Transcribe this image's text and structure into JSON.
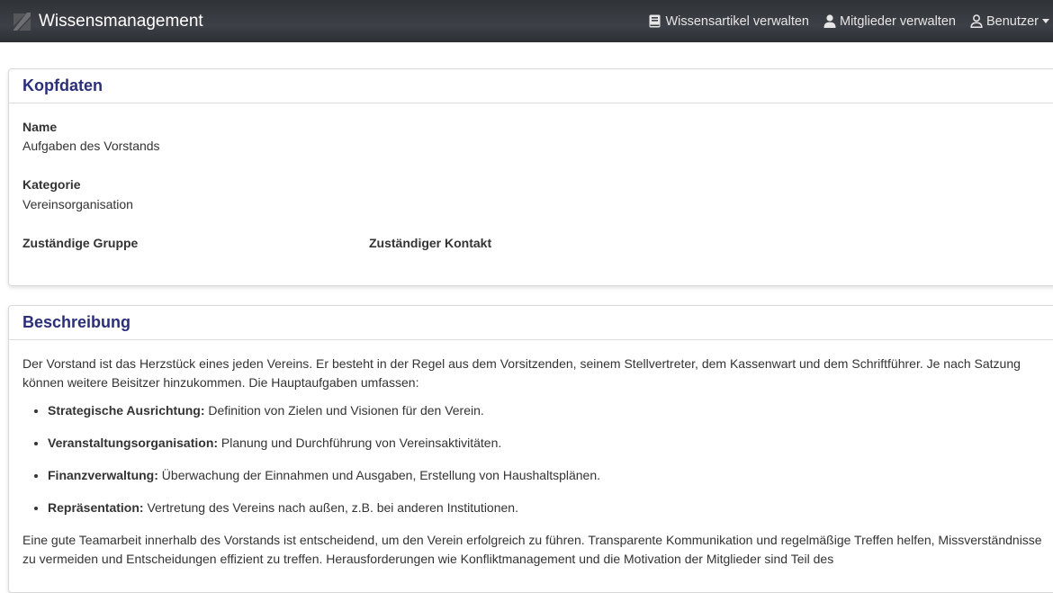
{
  "navbar": {
    "brand": "Wissensmanagement",
    "links": {
      "articles": "Wissensartikel verwalten",
      "members": "Mitglieder verwalten",
      "user": "Benutzer"
    }
  },
  "kopfdaten": {
    "title": "Kopfdaten",
    "name_label": "Name",
    "name_value": "Aufgaben des Vorstands",
    "category_label": "Kategorie",
    "category_value": "Vereinsorganisation",
    "group_label": "Zuständige Gruppe",
    "contact_label": "Zuständiger Kontakt"
  },
  "beschreibung": {
    "title": "Beschreibung",
    "intro": "Der Vorstand ist das Herzstück eines jeden Vereins. Er besteht in der Regel aus dem Vorsitzenden, seinem Stellvertreter, dem Kassenwart und dem Schriftführer. Je nach Satzung können weitere Beisitzer hinzukommen. Die Hauptaufgaben umfassen:",
    "items": [
      {
        "term": "Strategische Ausrichtung:",
        "text": " Definition von Zielen und Visionen für den Verein."
      },
      {
        "term": "Veranstaltungsorganisation:",
        "text": " Planung und Durchführung von Vereinsaktivitäten."
      },
      {
        "term": "Finanzverwaltung:",
        "text": " Überwachung der Einnahmen und Ausgaben, Erstellung von Haushaltsplänen."
      },
      {
        "term": "Repräsentation:",
        "text": " Vertretung des Vereins nach außen, z.B. bei anderen Institutionen."
      }
    ],
    "outro": "Eine gute Teamarbeit innerhalb des Vorstands ist entscheidend, um den Verein erfolgreich zu führen. Transparente Kommunikation und regelmäßige Treffen helfen, Missverständnisse zu vermeiden und Entscheidungen effizient zu treffen. Herausforderungen wie Konfliktmanagement und die Motivation der Mitglieder sind Teil des"
  }
}
